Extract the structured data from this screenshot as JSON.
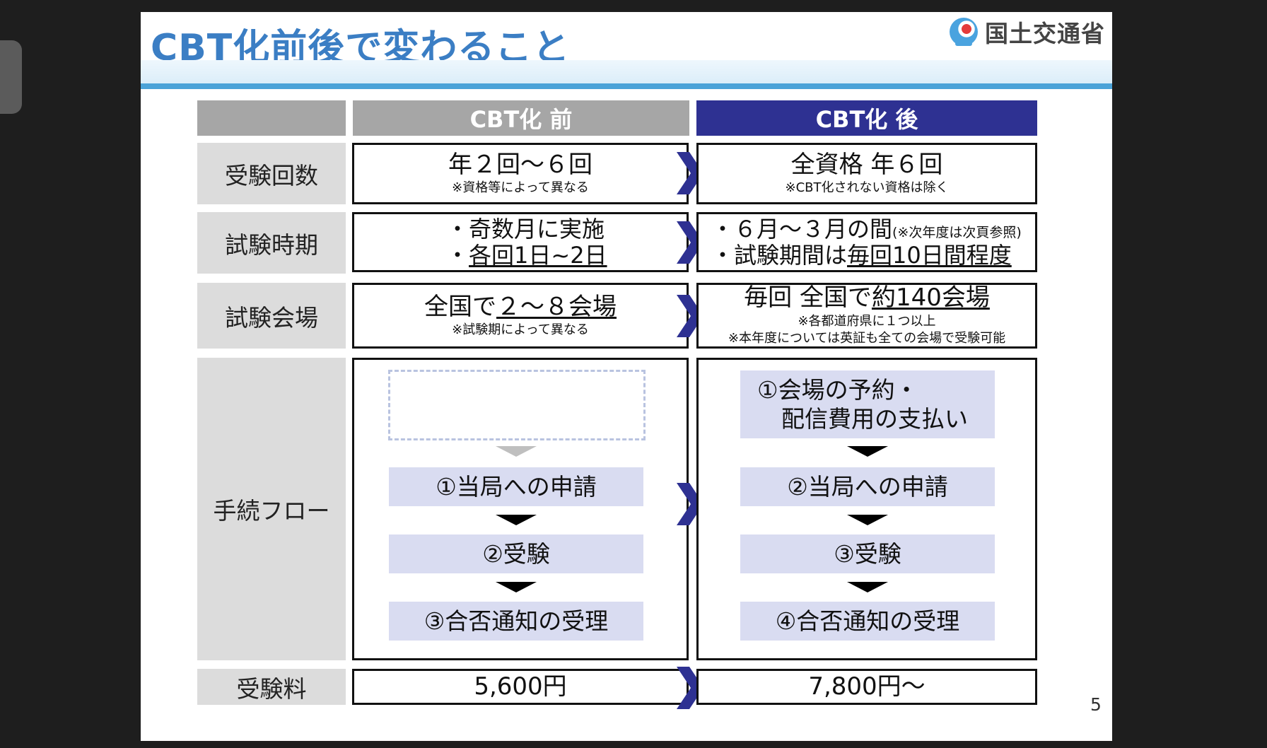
{
  "slide": {
    "title": "CBT化前後で変わること",
    "org": "国土交通省",
    "page_number": "5"
  },
  "columns": {
    "before": "CBT化 前",
    "after": "CBT化 後"
  },
  "rows": {
    "count": {
      "label": "受験回数",
      "before_main": "年２回～６回",
      "before_note": "※資格等によって異なる",
      "after_main": "全資格 年６回",
      "after_note": "※CBT化されない資格は除く"
    },
    "period": {
      "label": "試験時期",
      "before_line1": "・奇数月に実施",
      "before_line2_prefix": "・",
      "before_line2_underlined": "各回1日~2日",
      "after_line1_main": "・６月～３月の間",
      "after_line1_note": "(※次年度は次頁参照)",
      "after_line2_prefix": "・試験期間は",
      "after_line2_underlined": "毎回10日間程度"
    },
    "venue": {
      "label": "試験会場",
      "before_prefix": "全国で",
      "before_underlined": "２～８会場",
      "before_note": "※試験期によって異なる",
      "after_prefix": "毎回 全国で",
      "after_underlined": "約140会場",
      "after_note1": "※各都道府県に１つ以上",
      "after_note2": "※本年度については英証も全ての会場で受験可能"
    },
    "flow": {
      "label": "手続フロー",
      "before_steps": [
        "①当局への申請",
        "②受験",
        "③合否通知の受理"
      ],
      "after_step1_line1": "①会場の予約・",
      "after_step1_line2": "配信費用の支払い",
      "after_steps": [
        "②当局への申請",
        "③受験",
        "④合否通知の受理"
      ]
    },
    "fee": {
      "label": "受験料",
      "before": "5,600円",
      "after": "7,800円～"
    }
  },
  "colors": {
    "title": "#3b7ec4",
    "header_after": "#2e3192",
    "header_before": "#a6a6a6",
    "label_bg": "#dcdcdc",
    "step_bg": "#d9dcf1",
    "arrow": "#2e3192"
  }
}
